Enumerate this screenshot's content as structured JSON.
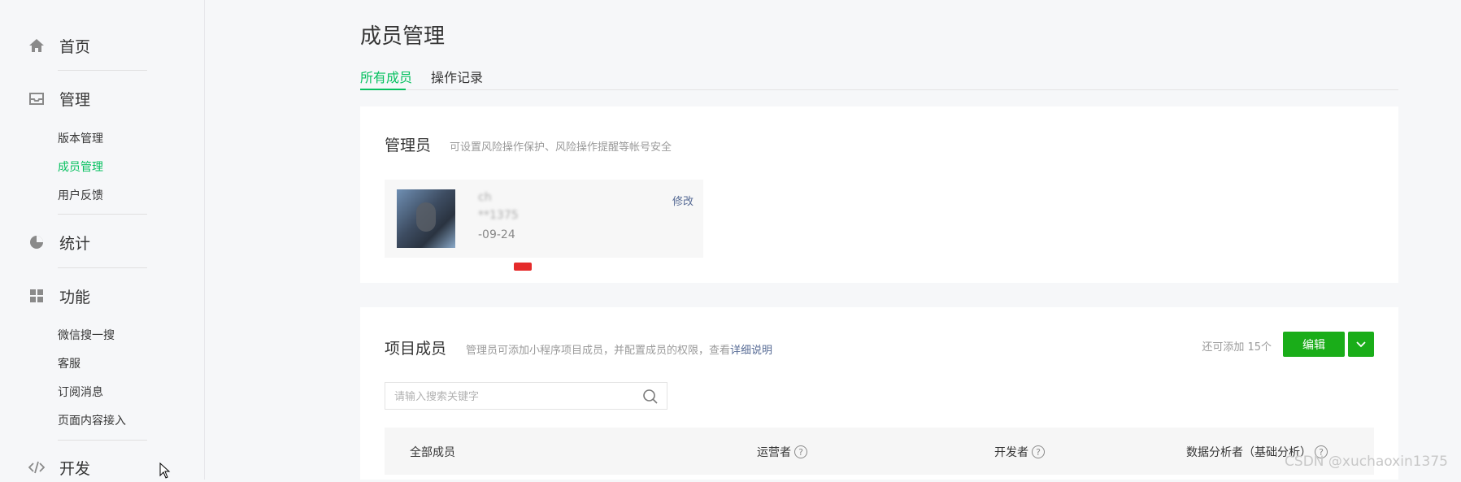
{
  "sidebar": {
    "home": "首页",
    "manage": "管理",
    "manage_items": [
      "版本管理",
      "成员管理",
      "用户反馈"
    ],
    "stats": "统计",
    "features": "功能",
    "feature_items": [
      "微信搜一搜",
      "客服",
      "订阅消息",
      "页面内容接入"
    ],
    "dev": "开发"
  },
  "page": {
    "title": "成员管理",
    "tabs": [
      "所有成员",
      "操作记录"
    ]
  },
  "admin": {
    "heading": "管理员",
    "desc": "可设置风险操作保护、风险操作提醒等帐号安全",
    "name": "ch",
    "wechat": "**1375",
    "date": "-09-24",
    "edit": "修改"
  },
  "members": {
    "heading": "项目成员",
    "desc": "管理员可添加小程序项目成员，并配置成员的权限，查看",
    "desc_link": "详细说明",
    "quota": "还可添加 15个",
    "edit_button": "编辑",
    "search_placeholder": "请输入搜索关键字",
    "columns": [
      "全部成员",
      "运营者",
      "开发者",
      "数据分析者（基础分析）"
    ],
    "help_symbol": "?"
  },
  "watermark": "CSDN @xuchaoxin1375",
  "colors": {
    "accent": "#07c160",
    "button": "#1aad19",
    "link": "#576b95"
  }
}
